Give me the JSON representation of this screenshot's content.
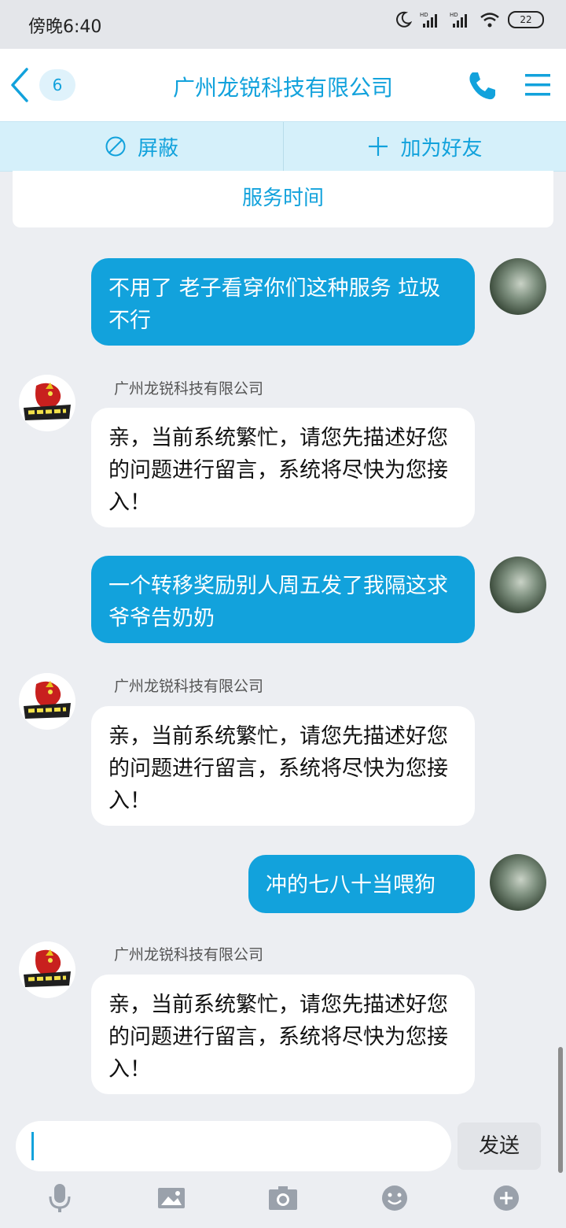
{
  "status_bar": {
    "time": "傍晚6:40",
    "battery": "22"
  },
  "header": {
    "unread_count": "6",
    "title": "广州龙锐科技有限公司"
  },
  "actions": {
    "block_label": "屏蔽",
    "add_friend_label": "加为好友"
  },
  "service_time_label": "服务时间",
  "messages": [
    {
      "from": "me",
      "text": "不用了 老子看穿你们这种服务 垃圾不行"
    },
    {
      "from": "company",
      "sender": "广州龙锐科技有限公司",
      "text": "亲，当前系统繁忙，请您先描述好您的问题进行留言，系统将尽快为您接入！"
    },
    {
      "from": "me",
      "text": "一个转移奖励别人周五发了我隔这求爷爷告奶奶"
    },
    {
      "from": "company",
      "sender": "广州龙锐科技有限公司",
      "text": "亲，当前系统繁忙，请您先描述好您的问题进行留言，系统将尽快为您接入！"
    },
    {
      "from": "me",
      "text": "冲的七八十当喂狗"
    },
    {
      "from": "company",
      "sender": "广州龙锐科技有限公司",
      "text": "亲，当前系统繁忙，请您先描述好您的问题进行留言，系统将尽快为您接入！"
    }
  ],
  "input": {
    "value": "",
    "send_label": "发送"
  },
  "toolbar": [
    "microphone-icon",
    "image-icon",
    "camera-icon",
    "emoji-icon",
    "plus-icon"
  ],
  "colors": {
    "accent": "#12a2dc",
    "background": "#eceef2",
    "action_bar": "#d5f0fa"
  }
}
